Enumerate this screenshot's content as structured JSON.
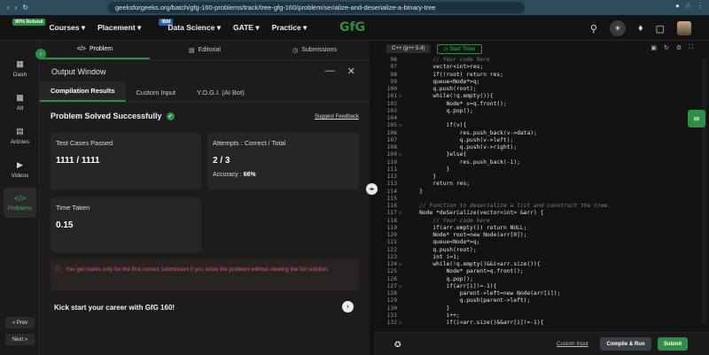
{
  "browser": {
    "url": "geeksforgeeks.org/batch/gfg-160-problems/track/tree-gfg-160/problem/serialize-and-deserialize-a-binary-tree"
  },
  "nav": {
    "courses": "Courses",
    "courses_badge": "90% Refund",
    "placement": "Placement",
    "data_science": "Data Science",
    "data_science_badge": "IBM",
    "gate": "GATE",
    "practice": "Practice",
    "logo": "GfG"
  },
  "sidebar": {
    "items": [
      {
        "label": "Dash"
      },
      {
        "label": "All"
      },
      {
        "label": "Articles"
      },
      {
        "label": "Videos"
      },
      {
        "label": "Problems"
      }
    ],
    "prev": "« Prev",
    "next": "Next »"
  },
  "left_tabs": {
    "problem": "Problem",
    "editorial": "Editorial",
    "submissions": "Submissions"
  },
  "output": {
    "title": "Output Window",
    "tabs": [
      "Compilation Results",
      "Custom Input",
      "Y.O.G.I. (AI Bot)"
    ],
    "status": "Problem Solved Successfully",
    "feedback": "Suggest Feedback",
    "test_cases_label": "Test Cases Passed",
    "test_cases_value": "1111 / 1111",
    "attempts_label": "Attempts : Correct / Total",
    "attempts_value": "2 / 3",
    "accuracy_label": "Accuracy :",
    "accuracy_value": "66%",
    "time_label": "Time Taken",
    "time_value": "0.15",
    "warning": "You get marks only for the first correct submission if you solve the problem without viewing the full solution.",
    "kick": "Kick start your career with GfG 160!"
  },
  "editor": {
    "language": "C++ (g++ 5.4)",
    "timer": "Start Timer",
    "custom_input": "Custom Input",
    "compile": "Compile & Run",
    "submit": "Submit",
    "lines": [
      {
        "n": "96",
        "fold": "",
        "t": "        // Your code here",
        "c": true
      },
      {
        "n": "97",
        "fold": "",
        "t": "        vector<int>res;",
        "c": false
      },
      {
        "n": "98",
        "fold": "",
        "t": "        if(!root) return res;",
        "c": false
      },
      {
        "n": "99",
        "fold": "",
        "t": "        queue<Node*>q;",
        "c": false
      },
      {
        "n": "100",
        "fold": "",
        "t": "        q.push(root);",
        "c": false
      },
      {
        "n": "101",
        "fold": "v",
        "t": "        while(!q.empty()){",
        "c": false
      },
      {
        "n": "102",
        "fold": "",
        "t": "            Node* v=q.front();",
        "c": false
      },
      {
        "n": "103",
        "fold": "",
        "t": "            q.pop();",
        "c": false
      },
      {
        "n": "104",
        "fold": "",
        "t": "",
        "c": false
      },
      {
        "n": "105",
        "fold": "v",
        "t": "            if(v){",
        "c": false
      },
      {
        "n": "106",
        "fold": "",
        "t": "                res.push_back(v->data);",
        "c": false
      },
      {
        "n": "107",
        "fold": "",
        "t": "                q.push(v->left);",
        "c": false
      },
      {
        "n": "108",
        "fold": "",
        "t": "                q.push(v->right);",
        "c": false
      },
      {
        "n": "109",
        "fold": "v",
        "t": "            }else{",
        "c": false
      },
      {
        "n": "110",
        "fold": "",
        "t": "                res.push_back(-1);",
        "c": false
      },
      {
        "n": "111",
        "fold": "",
        "t": "            }",
        "c": false
      },
      {
        "n": "112",
        "fold": "",
        "t": "        }",
        "c": false
      },
      {
        "n": "113",
        "fold": "",
        "t": "        return res;",
        "c": false
      },
      {
        "n": "114",
        "fold": "",
        "t": "    }",
        "c": false
      },
      {
        "n": "115",
        "fold": "",
        "t": "",
        "c": false
      },
      {
        "n": "116",
        "fold": "",
        "t": "    // Function to deserialize a list and construct the tree.",
        "c": true
      },
      {
        "n": "117",
        "fold": "v",
        "t": "    Node *deSerialize(vector<int> &arr) {",
        "c": false
      },
      {
        "n": "118",
        "fold": "",
        "t": "        // Your code here",
        "c": true
      },
      {
        "n": "119",
        "fold": "",
        "t": "        if(arr.empty()) return NULL;",
        "c": false
      },
      {
        "n": "120",
        "fold": "",
        "t": "        Node* root=new Node(arr[0]);",
        "c": false
      },
      {
        "n": "121",
        "fold": "",
        "t": "        queue<Node*>q;",
        "c": false
      },
      {
        "n": "122",
        "fold": "",
        "t": "        q.push(root);",
        "c": false
      },
      {
        "n": "123",
        "fold": "",
        "t": "        int i=1;",
        "c": false
      },
      {
        "n": "124",
        "fold": "v",
        "t": "        while(!q.empty()&&i<arr.size()){",
        "c": false
      },
      {
        "n": "125",
        "fold": "",
        "t": "            Node* parent=q.front();",
        "c": false
      },
      {
        "n": "126",
        "fold": "",
        "t": "            q.pop();",
        "c": false
      },
      {
        "n": "127",
        "fold": "v",
        "t": "            if(arr[i]!=-1){",
        "c": false
      },
      {
        "n": "128",
        "fold": "",
        "t": "                parent->left=new Node(arr[i]);",
        "c": false
      },
      {
        "n": "129",
        "fold": "",
        "t": "                q.push(parent->left);",
        "c": false
      },
      {
        "n": "130",
        "fold": "",
        "t": "            }",
        "c": false
      },
      {
        "n": "131",
        "fold": "",
        "t": "            i++;",
        "c": false
      },
      {
        "n": "132",
        "fold": "v",
        "t": "            if(i<arr.size()&&arr[i]!=-1){",
        "c": false
      }
    ]
  }
}
